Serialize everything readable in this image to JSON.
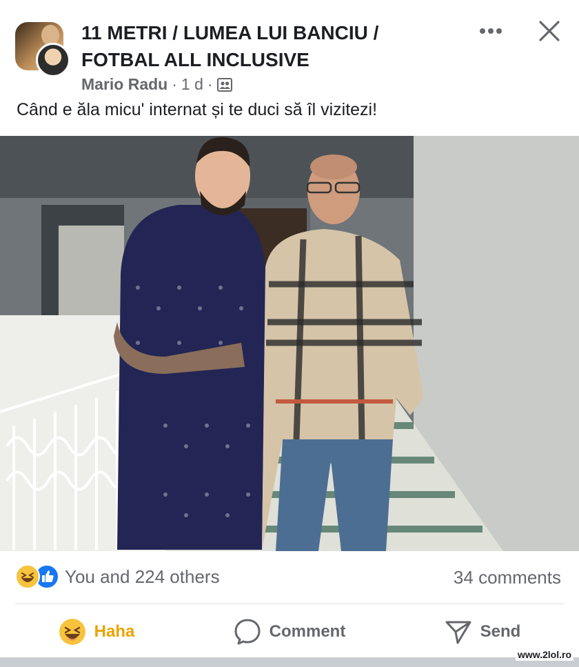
{
  "post": {
    "page_name": "11 METRI / LUMEA LUI BANCIU / FOTBAL ALL INCLUSIVE",
    "author": "Mario Radu",
    "time": "1 d",
    "separator": "·",
    "audience_icon": "group-icon",
    "caption": "Când e ăla micu' internat și te duci să îl vizitezi!"
  },
  "header_actions": {
    "more_icon": "more-horizontal-icon",
    "close_icon": "close-icon"
  },
  "stats": {
    "reaction_icons": [
      "haha-reaction-icon",
      "like-reaction-icon"
    ],
    "reactions_text": "You and 224 others",
    "comments_text": "34 comments"
  },
  "actions": [
    {
      "label": "Haha",
      "icon": "haha-emoji-icon",
      "active": true
    },
    {
      "label": "Comment",
      "icon": "comment-bubble-icon",
      "active": false
    },
    {
      "label": "Send",
      "icon": "send-icon",
      "active": false
    }
  ],
  "watermark": "www.2lol.ro",
  "colors": {
    "text_primary": "#1c1e21",
    "text_secondary": "#65676b",
    "like_blue": "#1877f2",
    "haha_yellow": "#f7c33c",
    "haha_active_label": "#e8a400"
  }
}
